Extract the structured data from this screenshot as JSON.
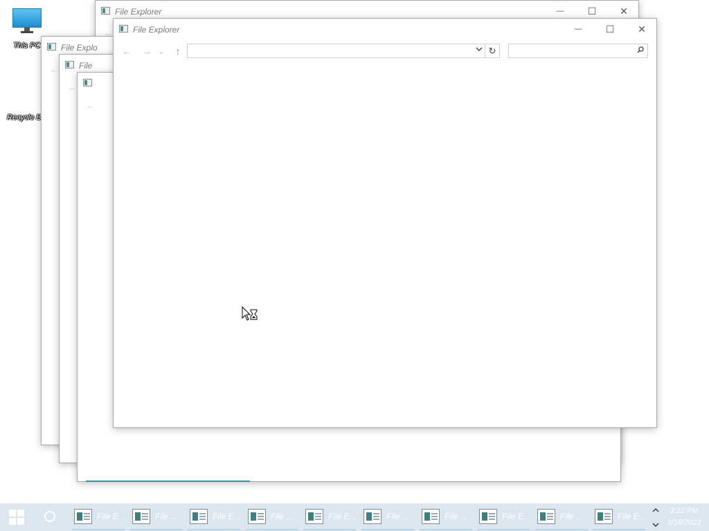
{
  "desktop": {
    "icons": [
      {
        "label": "This PC"
      },
      {
        "label": "Recycle B"
      }
    ]
  },
  "windows": {
    "back1_title": "File Explorer",
    "back2_title": "File Explo",
    "back3_title": "File",
    "main_title": "File Explorer",
    "minimize": "—",
    "maximize": "☐",
    "close": "✕"
  },
  "toolbar": {
    "back": "←",
    "forward": "→",
    "recent": "⌄",
    "up": "↑",
    "address_value": "",
    "search_value": "",
    "refresh": "↻"
  },
  "taskbar": {
    "items": [
      {
        "label": "File E..."
      },
      {
        "label": "File ..."
      },
      {
        "label": "File E..."
      },
      {
        "label": "File ..."
      },
      {
        "label": "File E..."
      },
      {
        "label": "File ..."
      },
      {
        "label": "File ..."
      },
      {
        "label": "File E..."
      },
      {
        "label": "File ..."
      },
      {
        "label": "File E..."
      }
    ],
    "clock_time": "3:22 PM",
    "clock_date": "3/16/2022"
  }
}
